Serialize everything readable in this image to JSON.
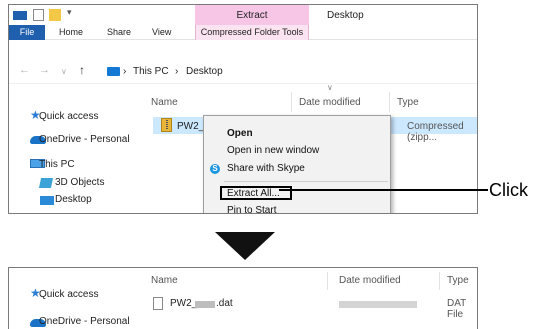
{
  "top_window": {
    "title": "Desktop",
    "context_tab_top": "Extract",
    "ribbon_tabs": [
      "File",
      "Home",
      "Share",
      "View",
      "Compressed Folder Tools"
    ],
    "address": {
      "pc": "This PC",
      "folder": "Desktop",
      "separator": "›"
    },
    "columns": {
      "name": "Name",
      "date_modified": "Date modified",
      "type": "Type"
    },
    "nav_items": [
      "Quick access",
      "OneDrive - Personal",
      "This PC",
      "3D Objects",
      "Desktop"
    ],
    "file": {
      "name": "PW2_",
      "type": "Compressed (zipp..."
    },
    "context_menu": {
      "items": [
        "Open",
        "Open in new window",
        "Share with Skype",
        "Extract All...",
        "Pin to Start"
      ],
      "skype_letter": "S"
    },
    "accent_color": "#1f5fae"
  },
  "callout": {
    "label": "Click"
  },
  "bottom_window": {
    "columns": {
      "name": "Name",
      "date_modified": "Date modified",
      "type": "Type"
    },
    "nav_items": [
      "Quick access",
      "OneDrive - Personal"
    ],
    "file": {
      "name_prefix": "PW2_",
      "name_suffix": ".dat",
      "type": "DAT File"
    }
  },
  "icons": [
    "quick-access-star-icon",
    "onedrive-cloud-icon",
    "this-pc-icon",
    "3d-objects-icon",
    "desktop-folder-icon",
    "zip-folder-icon",
    "skype-icon",
    "dat-file-icon",
    "down-arrow-icon"
  ]
}
